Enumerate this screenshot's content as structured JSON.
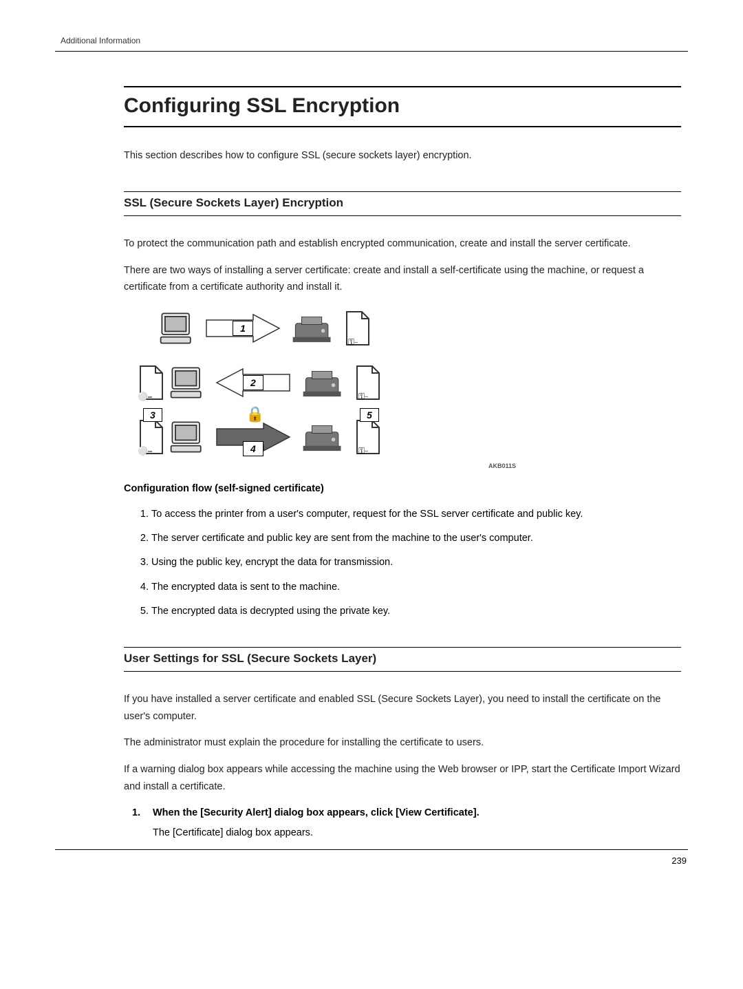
{
  "header": {
    "label": "Additional Information"
  },
  "title": "Configuring SSL Encryption",
  "intro": "This section describes how to configure SSL (secure sockets layer) encryption.",
  "section1": {
    "heading": "SSL (Secure Sockets Layer) Encryption",
    "para1": "To protect the communication path and establish encrypted communication, create and install the server certificate.",
    "para2": "There are two ways of installing a server certificate: create and install a self-certificate using the machine, or request a certificate from a certificate authority and install it.",
    "diagramLabels": {
      "l1": "1",
      "l2": "2",
      "l3": "3",
      "l4": "4",
      "l5": "5"
    },
    "diagramCode": "AKB011S",
    "subheading": "Configuration flow (self-signed certificate)",
    "steps": [
      "To access the printer from a user's computer, request for the SSL server certificate and public key.",
      "The server certificate and public key are sent from the machine to the user's computer.",
      "Using the public key, encrypt the data for transmission.",
      "The encrypted data is sent to the machine.",
      "The encrypted data is decrypted using the private key."
    ]
  },
  "section2": {
    "heading": "User Settings for SSL (Secure Sockets Layer)",
    "para1": "If you have installed a server certificate and enabled SSL (Secure Sockets Layer), you need to install the certificate on the user's computer.",
    "para2": "The administrator must explain the procedure for installing the certificate to users.",
    "para3": "If a warning dialog box appears while accessing the machine using the Web browser or IPP, start the Certificate Import Wizard and install a certificate.",
    "step1": {
      "num": "1.",
      "title": "When the [Security Alert] dialog box appears, click [View Certificate].",
      "note": "The [Certificate] dialog box appears."
    }
  },
  "pageNumber": "239"
}
